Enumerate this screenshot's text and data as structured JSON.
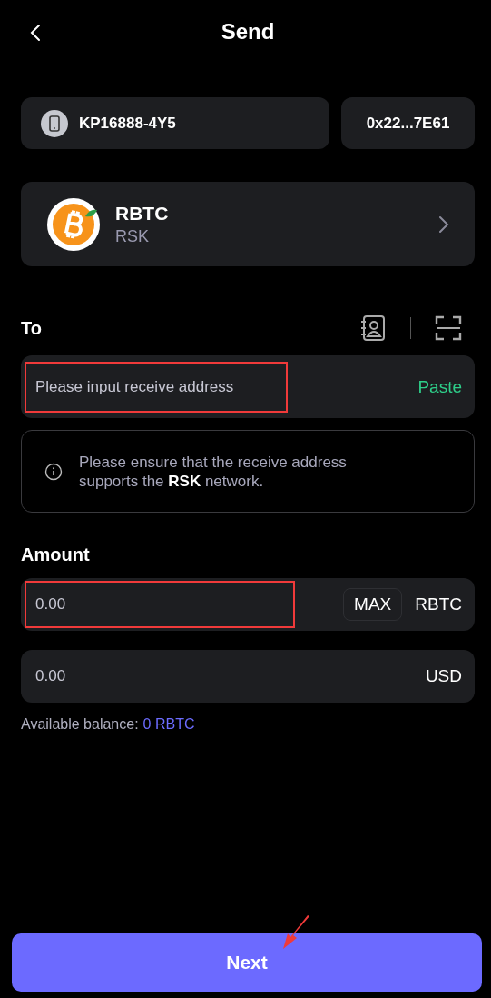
{
  "header": {
    "title": "Send"
  },
  "account": {
    "device_name": "KP16888-4Y5",
    "address": "0x22...7E61"
  },
  "token": {
    "symbol": "RBTC",
    "network": "RSK"
  },
  "to": {
    "label": "To",
    "placeholder": "Please input receive address",
    "highlighted": true,
    "paste": "Paste"
  },
  "notice": "Please ensure that the receive address supports the **RSK** network.",
  "amount": {
    "label": "Amount",
    "placeholder": "0.00",
    "highlighted": true,
    "max": "MAX",
    "unit": "RBTC"
  },
  "fiat": {
    "placeholder": "0.00",
    "unit": "USD"
  },
  "balance": {
    "label": "Available balance:",
    "value": "0 RBTC"
  },
  "next_button": {
    "label": "Next",
    "arrow_marked": true
  }
}
